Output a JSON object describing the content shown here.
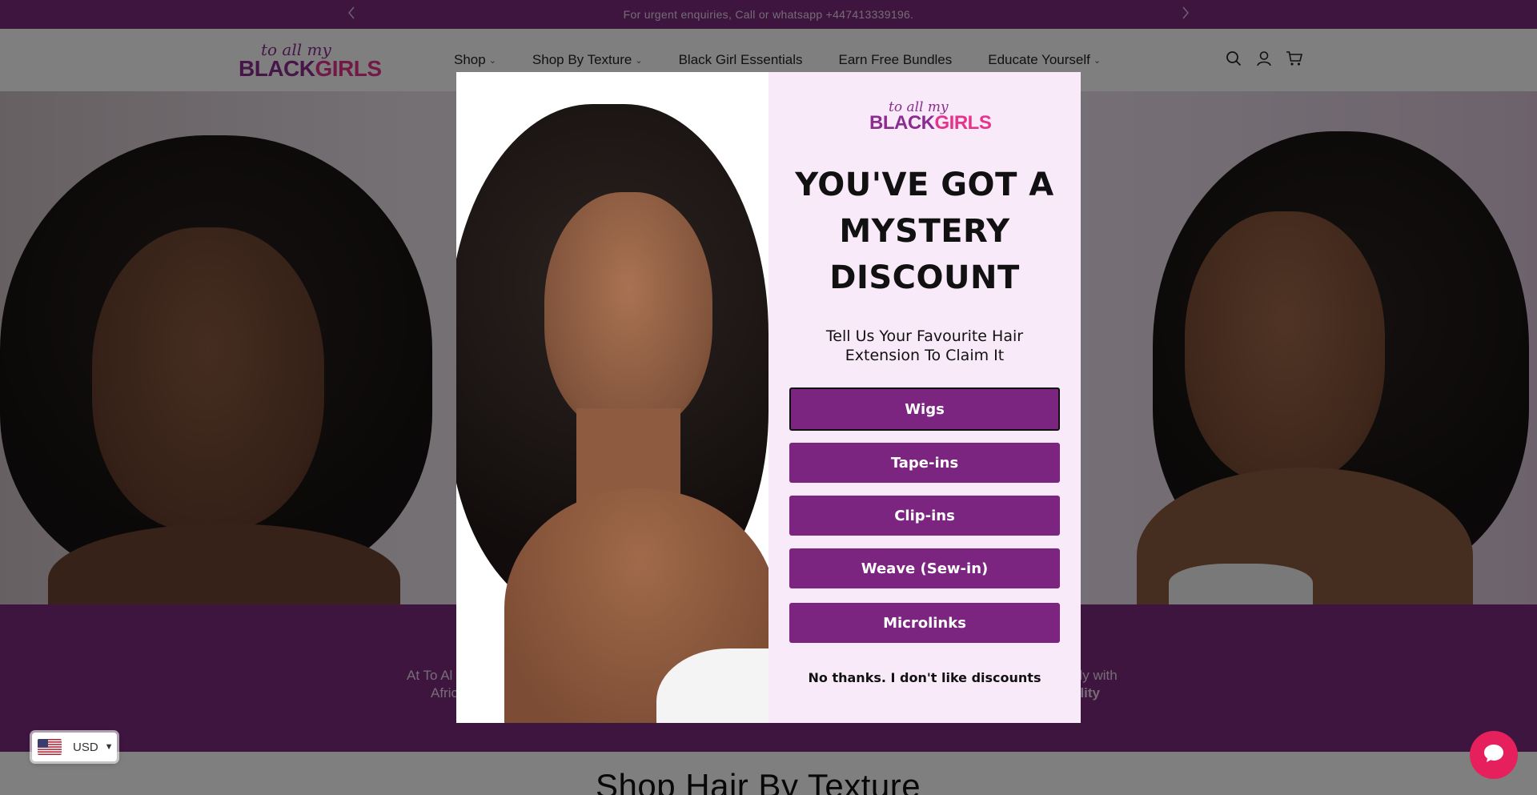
{
  "announcement": {
    "text": "For urgent enquiries, Call or whatsapp +447413339196.",
    "prev_icon": "chevron-left-icon",
    "next_icon": "chevron-right-icon"
  },
  "brand": {
    "script": "to all my",
    "word_dark": "BLACK",
    "word_pink": "GIRLS",
    "color_primary": "#7b2b7e",
    "color_pink": "#e6338c"
  },
  "nav": {
    "items": [
      {
        "label": "Shop",
        "has_dropdown": true
      },
      {
        "label": "Shop By Texture",
        "has_dropdown": true
      },
      {
        "label": "Black Girl Essentials",
        "has_dropdown": false
      },
      {
        "label": "Earn Free Bundles",
        "has_dropdown": false
      },
      {
        "label": "Educate Yourself",
        "has_dropdown": true
      }
    ],
    "chevron": "⌄"
  },
  "header_icons": [
    "search-icon",
    "account-icon",
    "cart-icon"
  ],
  "about": {
    "left_line1": "At To Al",
    "left_line2": "Afric",
    "right_line1": "sly with",
    "right_line2": "ality"
  },
  "section": {
    "heading": "Shop Hair By Texture"
  },
  "currency": {
    "code": "USD",
    "flag": "us-flag-icon"
  },
  "chat": {
    "icon": "chat-bubble-icon",
    "color": "#e6205c"
  },
  "modal": {
    "headline": "YOU'VE GOT A MYSTERY DISCOUNT",
    "subhead": "Tell Us Your Favourite Hair Extension To Claim It",
    "options": [
      {
        "label": "Wigs",
        "selected": true
      },
      {
        "label": "Tape-ins",
        "selected": false
      },
      {
        "label": "Clip-ins",
        "selected": false
      },
      {
        "label": "Weave (Sew-in)",
        "selected": false
      },
      {
        "label": "Microlinks",
        "selected": false
      }
    ],
    "decline": "No thanks. I don't like discounts",
    "button_color": "#7c2580",
    "background": "#f9eaf9"
  }
}
